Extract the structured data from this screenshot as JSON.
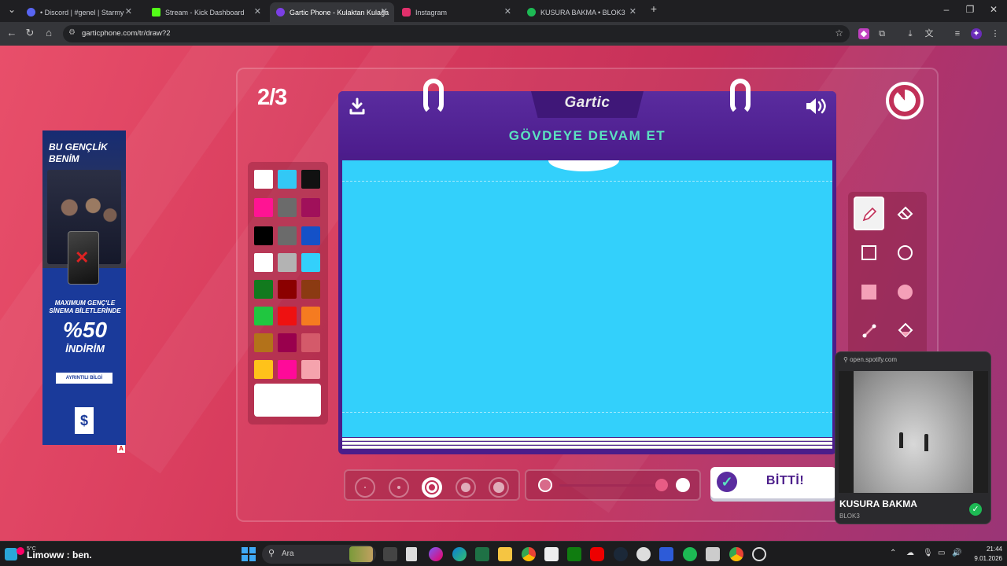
{
  "browser": {
    "tabs": [
      {
        "title": "• Discord | #genel | Starmy",
        "favicon_color": "#5865f2",
        "active": false
      },
      {
        "title": "Stream - Kick Dashboard",
        "favicon_color": "#53fc18",
        "active": false
      },
      {
        "title": "Gartic Phone - Kulaktan Kulağa",
        "favicon_color": "#7b3fe4",
        "active": true
      },
      {
        "title": "Instagram",
        "favicon_color": "#e1306c",
        "active": false
      },
      {
        "title": "KUSURA BAKMA • BLOK3",
        "favicon_color": "#1db954",
        "active": false
      }
    ],
    "url": "garticphone.com/tr/draw?2"
  },
  "game": {
    "round": "2/3",
    "logo": "Gartic",
    "prompt": "GÖVDEYE DEVAM ET",
    "done_label": "BİTTİ!",
    "timer_remaining_fraction": 0.89,
    "palette": [
      [
        "#ffffff",
        "#33c8f5",
        "#111111"
      ],
      [
        "#ff1493",
        "#6b6b6b",
        "#a0105a"
      ],
      [
        "#000000",
        "#6b6b6b",
        "#1451c8"
      ],
      [
        "#ffffff",
        "#b3b3b3",
        "#33d0fb"
      ],
      [
        "#127a1e",
        "#8b0000",
        "#8b3a12"
      ],
      [
        "#20c640",
        "#ee1111",
        "#f57b20"
      ],
      [
        "#b3721a",
        "#99004d",
        "#d45a6a"
      ],
      [
        "#ffc21a",
        "#ff0a99",
        "#f5a3ad"
      ]
    ],
    "selected_color": "#ffffff",
    "canvas_color": "#33d0fb",
    "tools": [
      "pen-icon",
      "eraser-icon",
      "rectangle-outline-icon",
      "circle-outline-icon",
      "rectangle-filled-icon",
      "circle-filled-icon",
      "line-icon",
      "fill-bucket-icon"
    ],
    "selected_tool": "pen",
    "brush_sizes": 5,
    "selected_brush_size_index": 2,
    "opacity_level": 1.0,
    "accent_color": "#c13058"
  },
  "ad": {
    "headline": "BU GENÇLİK BENİM",
    "line2": "MAXIMUM GENÇ'LE SİNEMA BİLETLERİNDE",
    "discount": "%50",
    "discount_word": "İNDİRİM",
    "cta": "AYRINTILI BİLGİ",
    "badge": "A"
  },
  "spotify": {
    "source": "open.spotify.com",
    "title": "KUSURA BAKMA",
    "artist": "BLOK3"
  },
  "taskbar": {
    "weather": "5°C",
    "stream_label": "Limoww : ben.",
    "search_placeholder": "Ara",
    "time": "21:44",
    "date": "9.01.2026"
  }
}
